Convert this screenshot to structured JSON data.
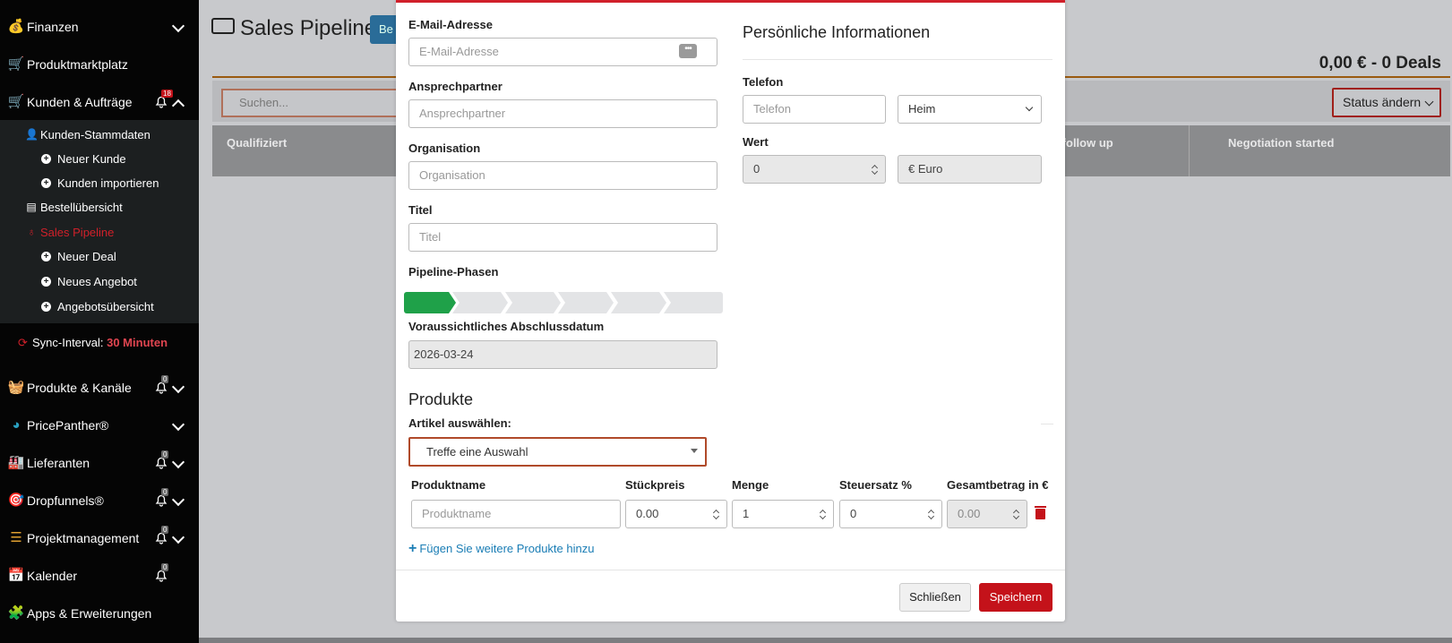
{
  "sidebar": {
    "items": [
      {
        "label": "Finanzen"
      },
      {
        "label": "Produktmarktplatz"
      },
      {
        "label": "Kunden & Aufträge",
        "badge": "18"
      },
      {
        "label": "Produkte & Kanäle",
        "badge": "0"
      },
      {
        "label": "PricePanther®"
      },
      {
        "label": "Lieferanten",
        "badge": "0"
      },
      {
        "label": "Dropfunnels®",
        "badge": "0"
      },
      {
        "label": "Projektmanagement",
        "badge": "0"
      },
      {
        "label": "Kalender",
        "badge": "0"
      },
      {
        "label": "Apps & Erweiterungen"
      }
    ],
    "subitems": [
      {
        "label": "Kunden-Stammdaten"
      },
      {
        "label": "Neuer Kunde"
      },
      {
        "label": "Kunden importieren"
      },
      {
        "label": "Bestellübersicht"
      },
      {
        "label": "Sales Pipeline"
      },
      {
        "label": "Neuer Deal"
      },
      {
        "label": "Neues Angebot"
      },
      {
        "label": "Angebotsübersicht"
      }
    ],
    "sync": {
      "label": "Sync-Interval:",
      "value": "30 Minuten"
    }
  },
  "main": {
    "title": "Sales Pipeline",
    "partial_button": "Be",
    "total": "0,00 € - 0 Deals",
    "search_placeholder": "Suchen...",
    "status_select": "Status ändern",
    "stages": [
      "Qualifiziert",
      "r follow up",
      "Negotiation started"
    ]
  },
  "modal": {
    "email": {
      "label": "E-Mail-Adresse",
      "placeholder": "E-Mail-Adresse"
    },
    "contact": {
      "label": "Ansprechpartner",
      "placeholder": "Ansprechpartner"
    },
    "org": {
      "label": "Organisation",
      "placeholder": "Organisation"
    },
    "title": {
      "label": "Titel",
      "placeholder": "Titel"
    },
    "phases_label": "Pipeline-Phasen",
    "phases_count": 6,
    "phases_active": 1,
    "close_date": {
      "label": "Voraussichtliches Abschlussdatum",
      "value": "2026-03-24"
    },
    "personal_heading": "Persönliche Informationen",
    "phone": {
      "label": "Telefon",
      "placeholder": "Telefon",
      "type_value": "Heim"
    },
    "value": {
      "label": "Wert",
      "amount": "0",
      "currency": "€ Euro"
    },
    "products_heading": "Produkte",
    "article_label": "Artikel auswählen:",
    "article_select": "Treffe eine Auswahl",
    "columns": [
      "Produktname",
      "Stückpreis",
      "Menge",
      "Steuersatz %",
      "Gesamtbetrag in €"
    ],
    "row": {
      "name_placeholder": "Produktname",
      "price": "0.00",
      "qty": "1",
      "tax": "0",
      "total": "0.00"
    },
    "add_more": "Fügen Sie weitere Produkte hinzu",
    "close_button": "Schließen",
    "save_button": "Speichern"
  },
  "colors": {
    "accent": "#c4121a",
    "success": "#1fa149",
    "link": "#1a7db5",
    "sidebar": "#050505"
  }
}
